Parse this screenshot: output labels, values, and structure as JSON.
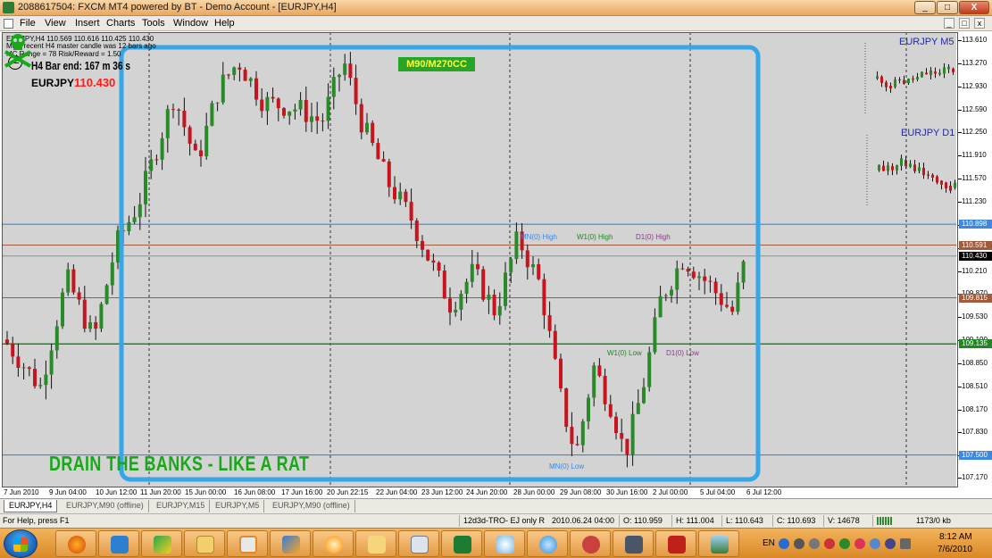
{
  "window": {
    "title": "2088617504: FXCM MT4 powered by BT - Demo Account - [EURJPY,H4]",
    "minimize": "_",
    "maximize": "□",
    "close": "X"
  },
  "menu": {
    "items": [
      "File",
      "View",
      "Insert",
      "Charts",
      "Tools",
      "Window",
      "Help"
    ],
    "mdi_buttons": [
      "_",
      "□",
      "x"
    ]
  },
  "chart": {
    "info": {
      "line1": "EURJPY,H4  110.569 110.616 110.425 110.430",
      "line2": "Most recent H4 master candle was 12 bars ago",
      "line3": "MC Range = 78  Risk/Reward = 1.50",
      "bar_end": "H4 Bar end: 167 m 36 s",
      "symbol": "EURJPY",
      "price": "110.430"
    },
    "strategy_badge": "M90/M270CC",
    "mini_charts": [
      "EURJPY  M5",
      "EURJPY  D1"
    ],
    "level_labels": {
      "mn_high": "MN(0) High",
      "w1_high": "W1(0) High",
      "d1_high": "D1(0) High",
      "w1_low": "W1(0) Low",
      "d1_low": "D1(0) Low",
      "mn_low": "MN(0) Low"
    },
    "slogan": "DRAIN THE BANKS - LIKE A RAT",
    "colors": {
      "bull": "#2a8a2a",
      "bear": "#c8141e",
      "frame": "#37a6e6",
      "mn_line": "#3c88e0",
      "w1_line": "#238523",
      "d1_line": "#8a3a8a",
      "brown_line": "#a05a3c"
    }
  },
  "price_axis": {
    "labels": [
      "113.610",
      "113.270",
      "112.930",
      "112.590",
      "112.250",
      "111.910",
      "111.570",
      "111.230",
      "110.890",
      "110.550",
      "110.210",
      "109.870",
      "109.530",
      "109.190",
      "108.850",
      "108.510",
      "108.170",
      "107.830",
      "107.490",
      "107.170"
    ],
    "tags": [
      {
        "text": "110.898",
        "color": "#3c88e0",
        "fg": "#ffffff",
        "price": 110.898
      },
      {
        "text": "110.591",
        "color": "#a05a3c",
        "fg": "#ffffff",
        "price": 110.591
      },
      {
        "text": "110.430",
        "color": "#000000",
        "fg": "#ffffff",
        "price": 110.43
      },
      {
        "text": "109.815",
        "color": "#a05a3c",
        "fg": "#ffffff",
        "price": 109.815
      },
      {
        "text": "109.135",
        "color": "#238523",
        "fg": "#ffffff",
        "price": 109.135
      },
      {
        "text": "107.500",
        "color": "#3c88e0",
        "fg": "#ffffff",
        "price": 107.5
      }
    ]
  },
  "time_axis": {
    "labels": [
      "7 Jun 2010",
      "9 Jun 04:00",
      "10 Jun 12:00",
      "11 Jun 20:00",
      "15 Jun 00:00",
      "16 Jun 08:00",
      "17 Jun 16:00",
      "20 Jun 22:15",
      "22 Jun 04:00",
      "23 Jun 12:00",
      "24 Jun 20:00",
      "28 Jun 00:00",
      "29 Jun 08:00",
      "30 Jun 16:00",
      "2 Jul 00:00",
      "5 Jul 04:00",
      "6 Jul 12:00"
    ]
  },
  "tabs": [
    "EURJPY,H4",
    "EURJPY,M90 (offline)",
    "EURJPY,M15",
    "EURJPY,M5",
    "EURJPY,M90 (offline)"
  ],
  "status": {
    "help": "For Help, press F1",
    "profile": "12d3d-TRO- EJ only R",
    "datetime": "2010.06.24 04:00",
    "open": "O: 110.959",
    "high": "H: 111.004",
    "low": "L: 110.643",
    "close": "C: 110.693",
    "volume": "V: 14678",
    "traffic": "1173/0 kb"
  },
  "taskbar": {
    "language": "EN",
    "time": "8:12 AM",
    "date": "7/6/2010"
  }
}
